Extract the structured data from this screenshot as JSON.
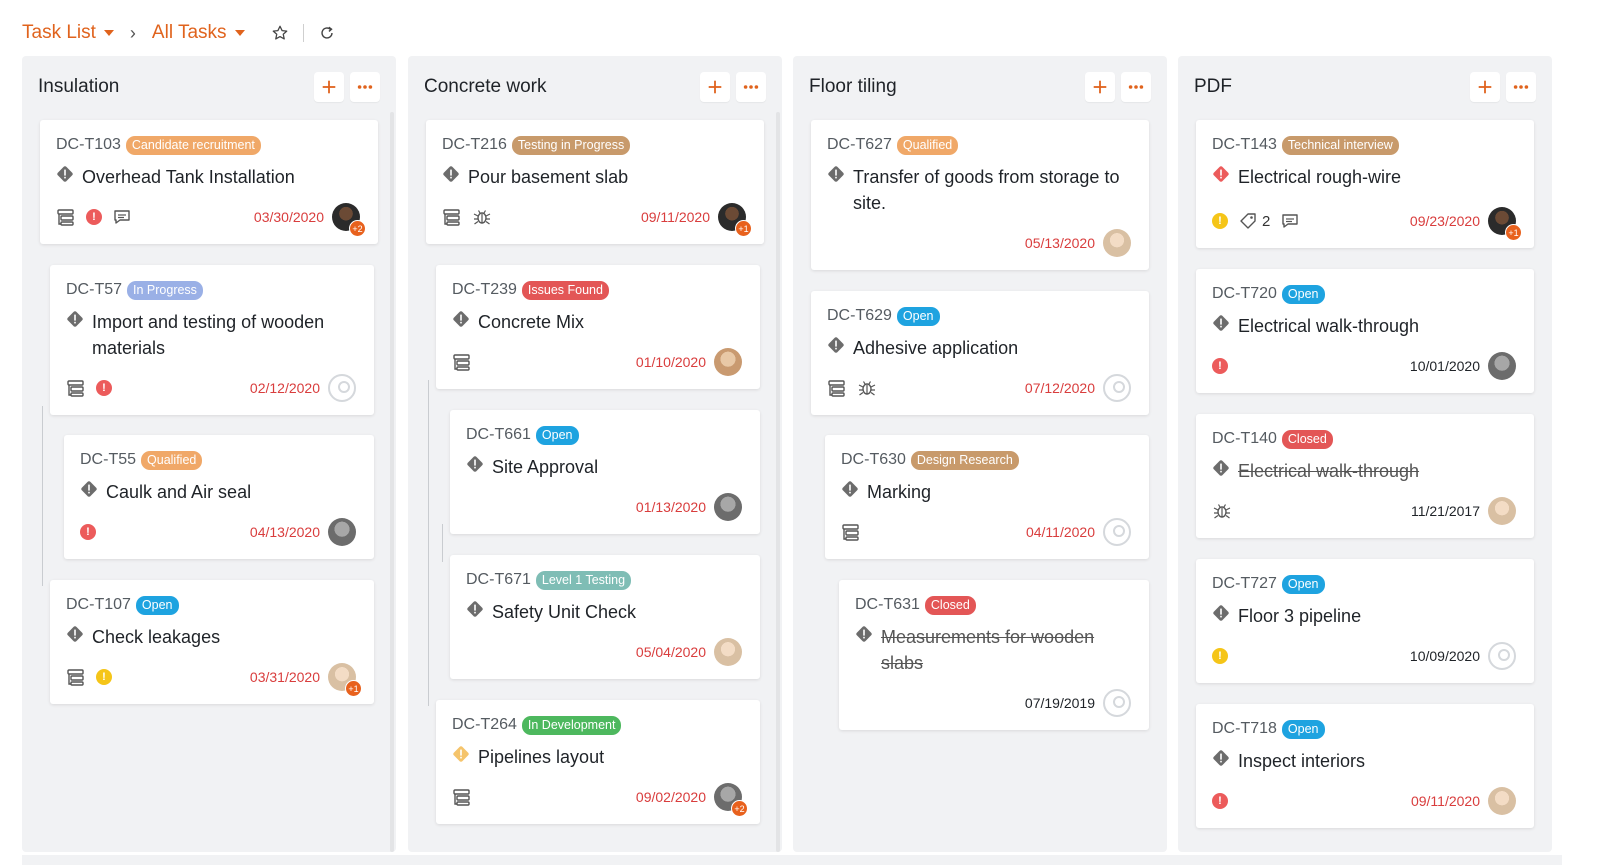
{
  "breadcrumb": {
    "list_label": "Task List",
    "view_label": "All Tasks"
  },
  "colors": {
    "accent": "#e0631d",
    "badge_orange": "#f0a868",
    "badge_tan": "#c89a6b",
    "badge_lavender": "#9ab0e6",
    "badge_red": "#e35656",
    "badge_blue": "#1ea3e0",
    "badge_teal": "#7fbdb5",
    "badge_green": "#4db85e",
    "priority_red": "#ec5b5b",
    "priority_yellow": "#f5c518"
  },
  "columns": [
    {
      "title": "Insulation",
      "cards": [
        {
          "id": "DC-T103",
          "status": "Candidate recruitment",
          "status_color": "#f0a868",
          "title": "Overhead Tank Installation",
          "due": "03/30/2020",
          "plus": "+2"
        },
        {
          "id": "DC-T57",
          "status": "In Progress",
          "status_color": "#9ab0e6",
          "title": "Import and testing of wooden materials",
          "due": "02/12/2020"
        },
        {
          "id": "DC-T55",
          "status": "Qualified",
          "status_color": "#f0a868",
          "title": "Caulk and Air seal",
          "due": "04/13/2020"
        },
        {
          "id": "DC-T107",
          "status": "Open",
          "status_color": "#1ea3e0",
          "title": "Check leakages",
          "due": "03/31/2020",
          "plus": "+1"
        }
      ]
    },
    {
      "title": "Concrete work",
      "cards": [
        {
          "id": "DC-T216",
          "status": "Testing in Progress",
          "status_color": "#c89a6b",
          "title": "Pour basement slab",
          "due": "09/11/2020",
          "plus": "+1"
        },
        {
          "id": "DC-T239",
          "status": "Issues Found",
          "status_color": "#e35656",
          "title": "Concrete Mix",
          "due": "01/10/2020"
        },
        {
          "id": "DC-T661",
          "status": "Open",
          "status_color": "#1ea3e0",
          "title": "Site Approval",
          "due": "01/13/2020"
        },
        {
          "id": "DC-T671",
          "status": "Level 1 Testing",
          "status_color": "#7fbdb5",
          "title": "Safety Unit Check",
          "due": "05/04/2020"
        },
        {
          "id": "DC-T264",
          "status": "In Development",
          "status_color": "#4db85e",
          "title": "Pipelines layout",
          "due": "09/02/2020",
          "plus": "+2"
        }
      ]
    },
    {
      "title": "Floor tiling",
      "cards": [
        {
          "id": "DC-T627",
          "status": "Qualified",
          "status_color": "#f0a868",
          "title": "Transfer of goods from storage to site.",
          "due": "05/13/2020"
        },
        {
          "id": "DC-T629",
          "status": "Open",
          "status_color": "#1ea3e0",
          "title": "Adhesive application",
          "due": "07/12/2020"
        },
        {
          "id": "DC-T630",
          "status": "Design Research",
          "status_color": "#c89a6b",
          "title": "Marking",
          "due": "04/11/2020"
        },
        {
          "id": "DC-T631",
          "status": "Closed",
          "status_color": "#e35656",
          "title": "Measurements for wooden slabs",
          "due": "07/19/2019"
        }
      ]
    },
    {
      "title": "PDF",
      "cards": [
        {
          "id": "DC-T143",
          "status": "Technical interview",
          "status_color": "#c89a6b",
          "title": "Electrical rough-wire",
          "due": "09/23/2020",
          "tag_count": "2",
          "plus": "+1"
        },
        {
          "id": "DC-T720",
          "status": "Open",
          "status_color": "#1ea3e0",
          "title": "Electrical walk-through",
          "due": "10/01/2020"
        },
        {
          "id": "DC-T140",
          "status": "Closed",
          "status_color": "#e35656",
          "title": "Electrical walk-through",
          "due": "11/21/2017"
        },
        {
          "id": "DC-T727",
          "status": "Open",
          "status_color": "#1ea3e0",
          "title": "Floor 3 pipeline",
          "due": "10/09/2020"
        },
        {
          "id": "DC-T718",
          "status": "Open",
          "status_color": "#1ea3e0",
          "title": "Inspect interiors",
          "due": "09/11/2020"
        }
      ]
    }
  ]
}
